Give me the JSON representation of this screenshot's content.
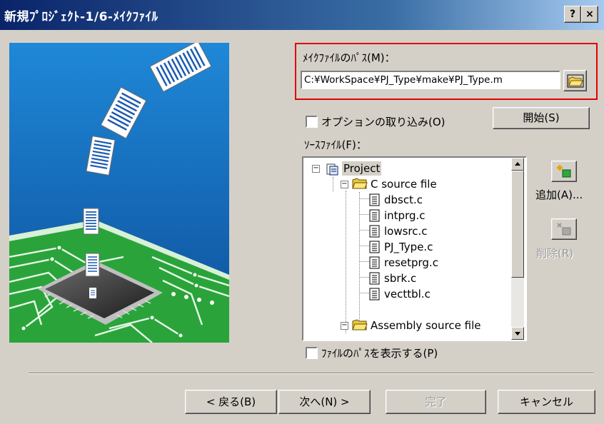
{
  "window": {
    "title": "新規ﾌﾟﾛｼﾞｪｸﾄ-1/6-ﾒｲｸﾌｧｲﾙ",
    "help_label": "?",
    "close_label": "×"
  },
  "makefile": {
    "label": "ﾒｲｸﾌｧｲﾙのﾊﾟｽ(M)：",
    "path_value": "C:¥WorkSpace¥PJ_Type¥make¥PJ_Type.m"
  },
  "options": {
    "import_label": "オプションの取り込み(O)",
    "import_checked": false,
    "start_label": "開始(S)"
  },
  "source": {
    "label": "ｿｰｽﾌｧｲﾙ(F)：",
    "tree": {
      "root": "Project",
      "folder1": "C source file",
      "files": [
        "dbsct.c",
        "intprg.c",
        "lowsrc.c",
        "PJ_Type.c",
        "resetprg.c",
        "sbrk.c",
        "vecttbl.c"
      ],
      "folder2": "Assembly source file"
    },
    "add_label": "追加(A)...",
    "delete_label": "削除(R)"
  },
  "show_path": {
    "label": "ﾌｧｲﾙのﾊﾟｽを表示する(P)",
    "checked": false
  },
  "footer": {
    "back_label": "< 戻る(B)",
    "next_label": "次へ(N) >",
    "finish_label": "完了",
    "cancel_label": "キャンセル"
  },
  "icons": {
    "folder": "folder-icon",
    "file": "document-icon",
    "project": "project-icon",
    "add": "add-file-icon",
    "delete": "delete-file-icon",
    "browse": "open-folder-icon"
  },
  "colors": {
    "title_bar": "#0a246a",
    "dialog_bg": "#d4d0c8",
    "highlight": "#e00000",
    "selection": "#0a246a",
    "illustration_sky": "#1a6fb8",
    "circuit_board": "#2aa43a"
  }
}
